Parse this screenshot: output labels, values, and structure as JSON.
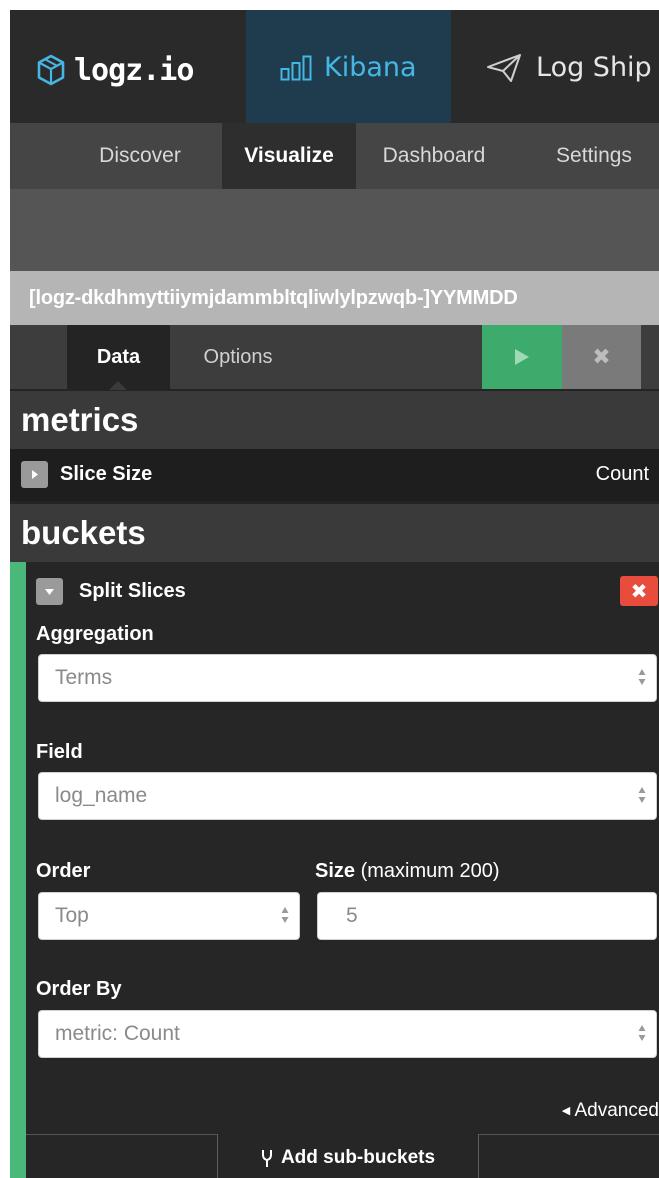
{
  "topnav": {
    "brand": "logz.io",
    "kibana_label": "Kibana",
    "logship_label": "Log Ship"
  },
  "subnav": {
    "discover": "Discover",
    "visualize": "Visualize",
    "dashboard": "Dashboard",
    "settings": "Settings"
  },
  "index_pattern": "[logz-dkdhmyttiiymjdammbltqliwlylpzwqb-]YYMMDD",
  "sidebar_tabs": {
    "data": "Data",
    "options": "Options",
    "discard_glyph": "✖"
  },
  "metrics": {
    "title": "metrics",
    "item": {
      "label": "Slice Size",
      "value": "Count"
    }
  },
  "buckets": {
    "title": "buckets",
    "item": {
      "label": "Split Slices",
      "remove_glyph": "✖",
      "aggregation_label": "Aggregation",
      "aggregation_value": "Terms",
      "field_label": "Field",
      "field_value": "log_name",
      "order_label": "Order",
      "order_value": "Top",
      "size_label": "Size",
      "size_hint": "(maximum 200)",
      "size_value": "5",
      "order_by_label": "Order By",
      "order_by_value": "metric: Count",
      "advanced_label": "Advanced"
    },
    "add_sub_buckets": "Add sub-buckets"
  },
  "colors": {
    "accent_blue": "#46b6e3",
    "apply_green": "#3cab6b",
    "remove_red": "#e74c3c",
    "bucket_edge": "#4ab879"
  }
}
